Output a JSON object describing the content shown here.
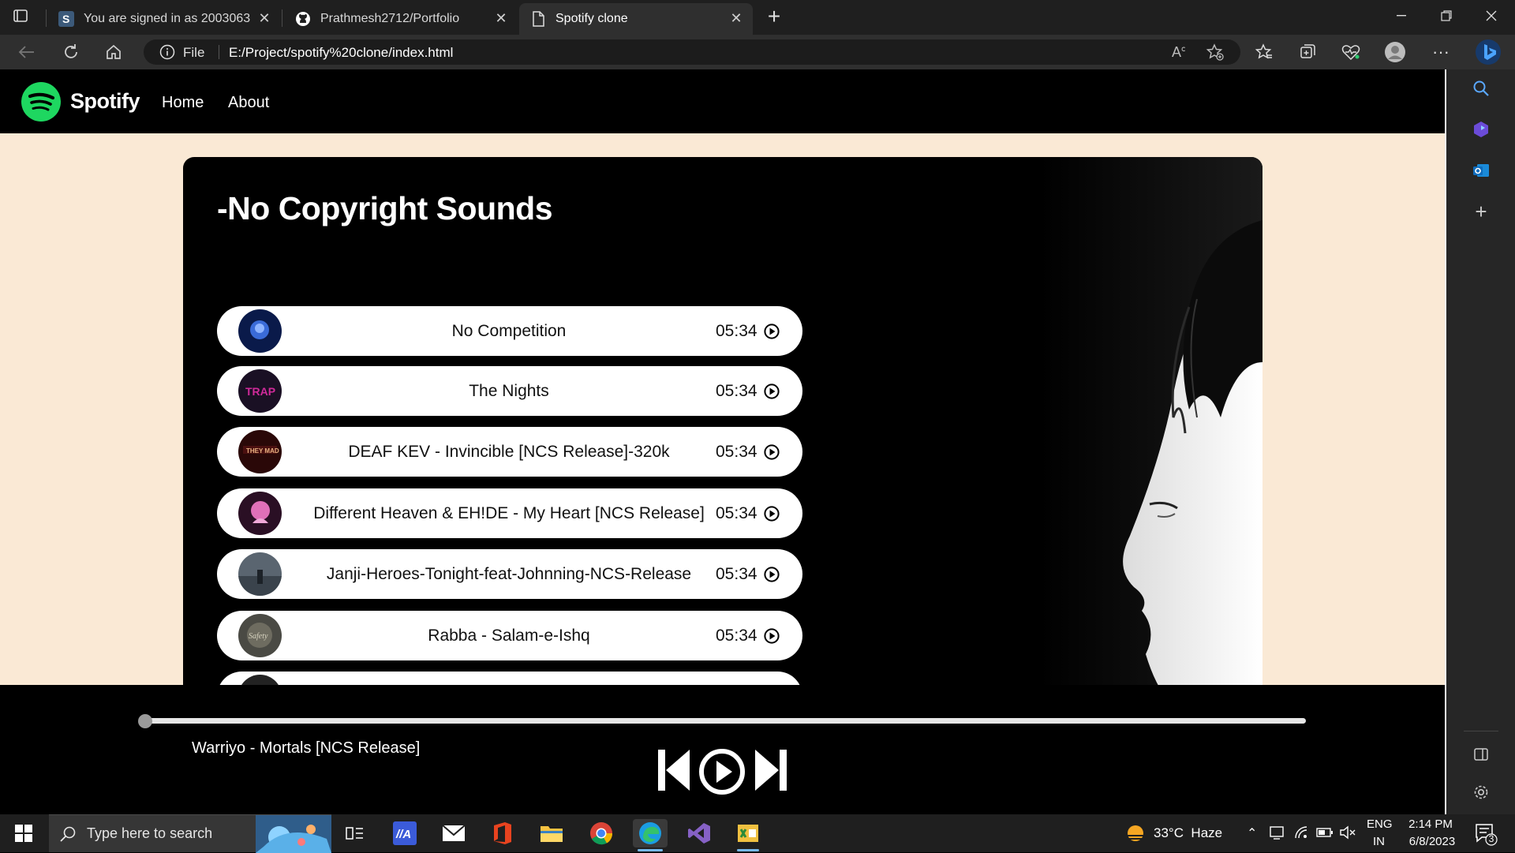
{
  "browser": {
    "tabs": [
      {
        "title": "You are signed in as 2003063",
        "active": false,
        "favicon": "s-icon"
      },
      {
        "title": "Prathmesh2712/Portfolio",
        "active": false,
        "favicon": "github-icon"
      },
      {
        "title": "Spotify clone",
        "active": true,
        "favicon": "page-icon"
      }
    ],
    "address": {
      "scheme_label": "File",
      "url": "E:/Project/spotify%20clone/index.html"
    }
  },
  "page": {
    "nav": {
      "brand": "Spotify",
      "links": [
        "Home",
        "About"
      ]
    },
    "container_title": "-No Copyright Sounds",
    "songs": [
      {
        "name": "No Competition",
        "duration": "05:34"
      },
      {
        "name": "The Nights",
        "duration": "05:34"
      },
      {
        "name": "DEAF KEV - Invincible [NCS Release]-320k",
        "duration": "05:34"
      },
      {
        "name": "Different Heaven & EH!DE - My Heart [NCS Release]",
        "duration": "05:34"
      },
      {
        "name": "Janji-Heroes-Tonight-feat-Johnning-NCS-Release",
        "duration": "05:34"
      },
      {
        "name": "Rabba - Salam-e-Ishq",
        "duration": "05:34"
      }
    ],
    "player": {
      "now_playing": "Warriyo - Mortals [NCS Release]",
      "progress_percent": 0
    }
  },
  "taskbar": {
    "search_placeholder": "Type here to search",
    "weather": "33°C  Haze",
    "language": "ENG",
    "region": "IN",
    "time": "2:14 PM",
    "date": "6/8/2023",
    "notification_count": "3"
  },
  "colors": {
    "page_background": "#fae9d5",
    "spotify_green": "#1ed760",
    "panel_black": "#000000"
  }
}
